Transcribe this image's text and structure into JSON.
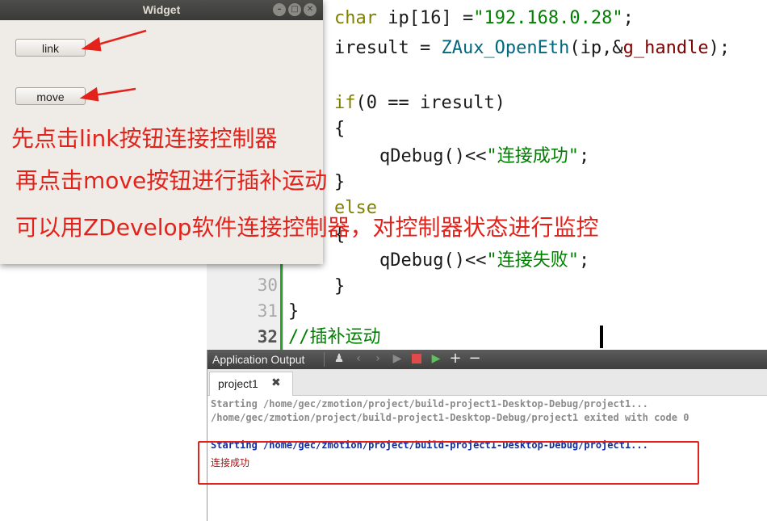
{
  "editor": {
    "line_numbers": {
      "l30": "30",
      "l31": "31",
      "l32": "32"
    },
    "code": {
      "line1": {
        "kw": "char",
        "mid": " ip[16] =",
        "str": "\"192.168.0.28\"",
        "end": ";"
      },
      "line2": {
        "a": "iresult = ",
        "fn": "ZAux_OpenEth",
        "b": "(ip,&",
        "vr": "g_handle",
        "c": ");"
      },
      "line3": {
        "kw": "if",
        "rest": "(0 == iresult)"
      },
      "line4": "{",
      "line5": {
        "a": "qDebug()<<",
        "str": "\"连接成功\"",
        "end": ";"
      },
      "line6": "}",
      "line7": "else",
      "line8": "{",
      "line9": {
        "a": "qDebug()<<",
        "str": "\"连接失败\"",
        "end": ";"
      },
      "line10": "}",
      "line11": "}",
      "line12": "//插补运动"
    }
  },
  "output": {
    "title": "Application Output",
    "tab_label": "project1",
    "tab_close": "✖",
    "lines": [
      "Starting /home/gec/zmotion/project/build-project1-Desktop-Debug/project1...",
      "/home/gec/zmotion/project/build-project1-Desktop-Debug/project1 exited with code 0",
      "Starting /home/gec/zmotion/project/build-project1-Desktop-Debug/project1...",
      "连接成功"
    ],
    "colors": {
      "gray": "#8a8a8a",
      "blue": "#0f2fa0",
      "red": "#b01010"
    }
  },
  "widget": {
    "title": "Widget",
    "buttons": {
      "link": "link",
      "move": "move"
    }
  },
  "annotations": {
    "line1": "先点击link按钮连接控制器",
    "line2": "再点击move按钮进行插补运动",
    "line3": "可以用ZDevelop软件连接控制器，对控制器状态进行监控",
    "color": "#e3231b"
  }
}
